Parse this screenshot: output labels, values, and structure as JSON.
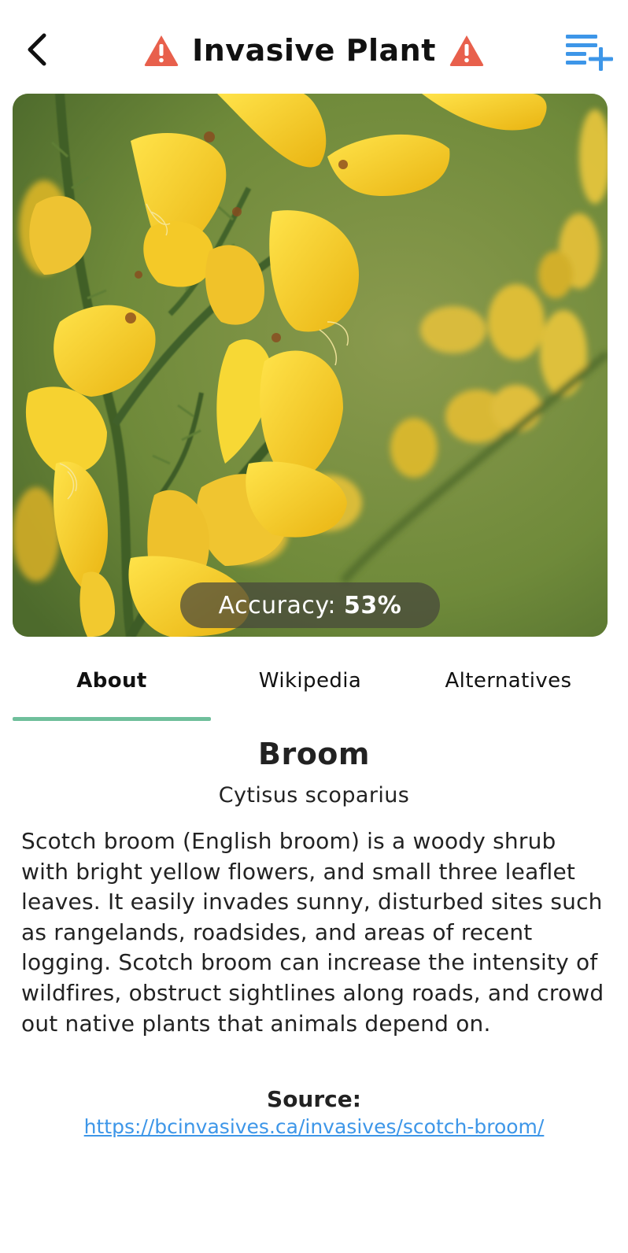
{
  "header": {
    "title": "Invasive Plant",
    "back_icon": "chevron-left-icon",
    "warning_icon": "warning-triangle-icon",
    "add_icon": "playlist-add-icon",
    "warning_color": "#e8604c",
    "accent_color": "#3d96e8"
  },
  "photo": {
    "accuracy_label": "Accuracy:",
    "accuracy_value": "53%"
  },
  "tabs": [
    {
      "label": "About",
      "active": true
    },
    {
      "label": "Wikipedia",
      "active": false
    },
    {
      "label": "Alternatives",
      "active": false
    }
  ],
  "tab_indicator_color": "#6fbf9b",
  "plant": {
    "name": "Broom",
    "scientific_name": "Cytisus scoparius",
    "description": "Scotch broom (English broom) is a woody shrub with bright yellow flowers, and small three leaflet leaves. It easily invades sunny, disturbed sites such as rangelands, roadsides, and areas of recent logging. Scotch broom can increase the intensity of wildfires, obstruct sightlines along roads, and crowd out native plants that animals depend on."
  },
  "source": {
    "label": "Source:",
    "url": "https://bcinvasives.ca/invasives/scotch-broom/"
  }
}
